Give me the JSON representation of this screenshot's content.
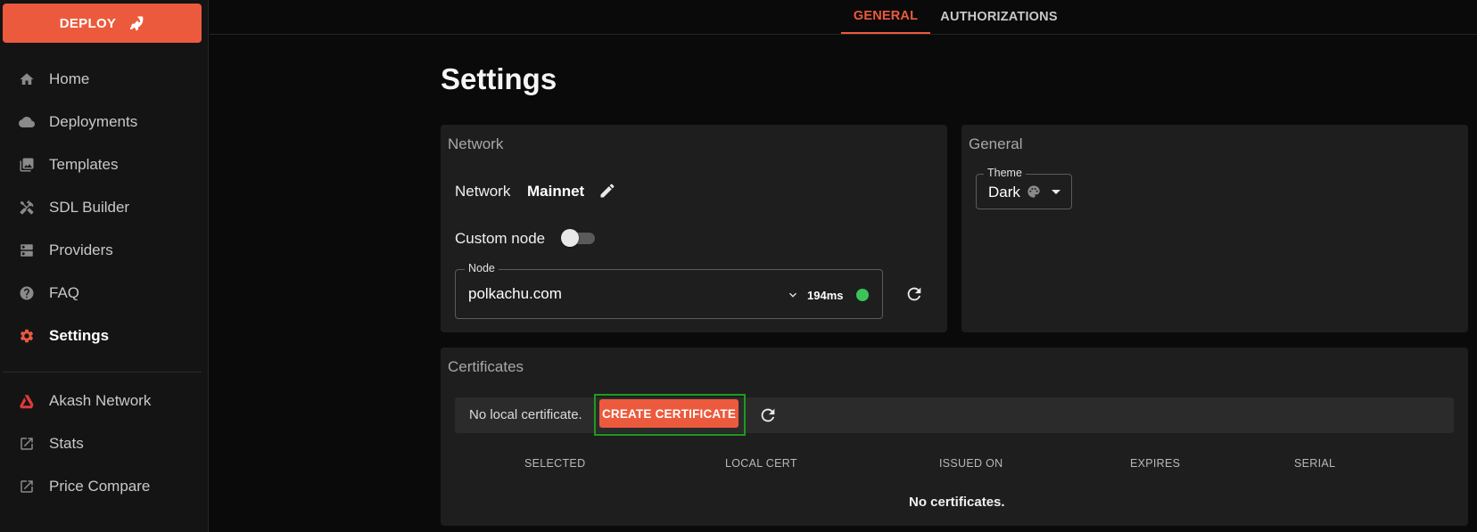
{
  "sidebar": {
    "deploy_label": "DEPLOY",
    "items": [
      {
        "label": "Home",
        "icon": "home-icon"
      },
      {
        "label": "Deployments",
        "icon": "cloud-icon"
      },
      {
        "label": "Templates",
        "icon": "templates-icon"
      },
      {
        "label": "SDL Builder",
        "icon": "tools-icon"
      },
      {
        "label": "Providers",
        "icon": "dns-icon"
      },
      {
        "label": "FAQ",
        "icon": "help-icon"
      },
      {
        "label": "Settings",
        "icon": "gear-icon",
        "active": true
      }
    ],
    "external": [
      {
        "label": "Akash Network",
        "icon": "akash-logo-icon"
      },
      {
        "label": "Stats",
        "icon": "external-link-icon"
      },
      {
        "label": "Price Compare",
        "icon": "external-link-icon"
      }
    ]
  },
  "tabs": [
    {
      "label": "GENERAL",
      "active": true
    },
    {
      "label": "AUTHORIZATIONS",
      "active": false
    }
  ],
  "page_title": "Settings",
  "network_card": {
    "title": "Network",
    "network_label": "Network",
    "network_value": "Mainnet",
    "custom_node_label": "Custom node",
    "custom_node_enabled": false,
    "node_field_label": "Node",
    "node_value": "polkachu.com",
    "latency": "194ms",
    "status_color": "#3ac45a"
  },
  "general_card": {
    "title": "General",
    "theme_label": "Theme",
    "theme_value": "Dark"
  },
  "certificates_card": {
    "title": "Certificates",
    "status_message": "No local certificate.",
    "create_button_label": "CREATE CERTIFICATE",
    "columns": [
      "SELECTED",
      "LOCAL CERT",
      "ISSUED ON",
      "EXPIRES",
      "SERIAL"
    ],
    "empty_message": "No certificates."
  },
  "colors": {
    "accent": "#ec5a3d",
    "background": "#0a0a0a",
    "card": "#1e1e1e",
    "highlight_outline": "#1e9a1e"
  }
}
